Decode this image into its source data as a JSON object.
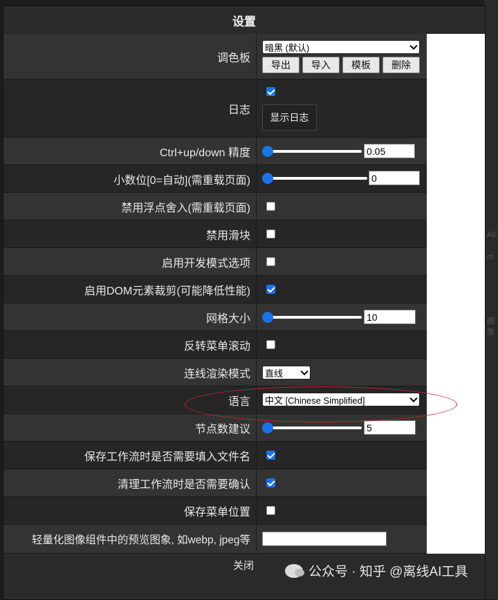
{
  "dialog": {
    "title": "设置",
    "close_label": "关闭"
  },
  "palette": {
    "label": "调色板",
    "selected": "暗黑 (默认)",
    "buttons": [
      "导出",
      "导入",
      "模板",
      "删除"
    ]
  },
  "log": {
    "label": "日志",
    "checked": true,
    "show_button": "显示日志"
  },
  "ctrl_precision": {
    "label": "Ctrl+up/down 精度",
    "value": "0.05",
    "level": 0.0
  },
  "decimal_places": {
    "label": "小数位[0=自动](需重载页面)",
    "value": "0",
    "level": 0.0
  },
  "disable_float_round": {
    "label": "禁用浮点舍入(需重载页面)",
    "checked": false
  },
  "disable_slider": {
    "label": "禁用滑块",
    "checked": false
  },
  "dev_mode": {
    "label": "启用开发模式选项",
    "checked": false
  },
  "dom_clipping": {
    "label": "启用DOM元素裁剪(可能降低性能)",
    "checked": true
  },
  "grid_size": {
    "label": "网格大小",
    "value": "10",
    "level": 0.0
  },
  "invert_menu_scroll": {
    "label": "反转菜单滚动",
    "checked": false
  },
  "link_render_mode": {
    "label": "连线渲染模式",
    "selected": "直线"
  },
  "language": {
    "label": "语言",
    "selected": "中文 [Chinese Simplified]"
  },
  "node_suggestions": {
    "label": "节点数建议",
    "value": "5",
    "level": 0.0
  },
  "prompt_filename": {
    "label": "保存工作流时是否需要填入文件名",
    "checked": true
  },
  "confirm_clear": {
    "label": "清理工作流时是否需要确认",
    "checked": true
  },
  "save_menu_position": {
    "label": "保存菜单位置",
    "checked": false
  },
  "preview_format": {
    "label": "轻量化图像组件中的预览图象, 如webp, jpeg等",
    "value": ""
  },
  "watermark": {
    "text": "公众号 · 知乎 @离线AI工具"
  },
  "colors": {
    "accent": "#1a73e8",
    "annotation": "#c0262e"
  }
}
